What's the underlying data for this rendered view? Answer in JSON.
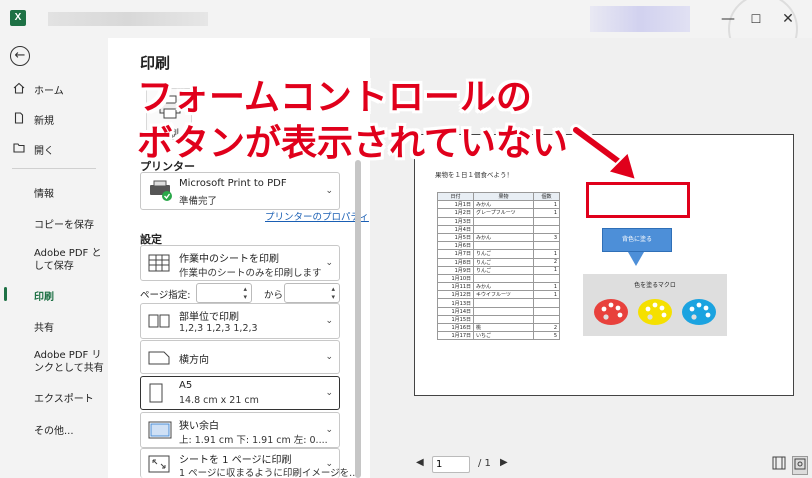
{
  "titlebar": {
    "app_icon": "excel-icon",
    "logo_letter": "X",
    "minimize_glyph": "—",
    "maximize_glyph": "☐",
    "close_glyph": "✕"
  },
  "nav": {
    "back_glyph": "←",
    "items": [
      {
        "label": "ホーム",
        "icon": "home-icon"
      },
      {
        "label": "新規",
        "icon": "new-file-icon"
      },
      {
        "label": "開く",
        "icon": "folder-open-icon"
      },
      {
        "label": "情報"
      },
      {
        "label": "コピーを保存"
      },
      {
        "label": "Adobe PDF と",
        "label2": "して保存"
      },
      {
        "label": "印刷",
        "active": true
      },
      {
        "label": "共有"
      },
      {
        "label": "Adobe PDF リ",
        "label2": "ンクとして共有"
      },
      {
        "label": "エクスポート"
      },
      {
        "label": "その他..."
      }
    ]
  },
  "print_pane": {
    "title": "印刷",
    "print_button_label": "印刷",
    "printer_section": "プリンター",
    "printer_name": "Microsoft Print to PDF",
    "printer_status": "準備完了",
    "printer_properties": "プリンターのプロパティ",
    "settings_section": "設定",
    "scope": {
      "l1": "作業中のシートを印刷",
      "l2": "作業中のシートのみを印刷します"
    },
    "page_spec_label": "ページ指定:",
    "page_to_label": "から",
    "collate": {
      "l1": "部単位で印刷",
      "l2": "1,2,3    1,2,3    1,2,3"
    },
    "orientation": {
      "l1": "横方向"
    },
    "paper": {
      "l1": "A5",
      "l2": "14.8 cm x 21 cm"
    },
    "margins": {
      "l1": "狭い余白",
      "l2": "上: 1.91 cm 下: 1.91 cm 左: 0...."
    },
    "scaling": {
      "l1": "シートを 1 ページに印刷",
      "l2": "1 ページに収まるように印刷イメージを..."
    }
  },
  "preview": {
    "sheet_title": "果物を１日１個食べよう！",
    "table_headers": [
      "日付",
      "果物",
      "個数"
    ],
    "rows": [
      [
        "1月1日",
        "みかん",
        "1"
      ],
      [
        "1月2日",
        "グレープフルーツ",
        "1"
      ],
      [
        "1月3日",
        "",
        ""
      ],
      [
        "1月4日",
        "",
        ""
      ],
      [
        "1月5日",
        "みかん",
        "3"
      ],
      [
        "1月6日",
        "",
        ""
      ],
      [
        "1月7日",
        "りんご",
        "1"
      ],
      [
        "1月8日",
        "りんご",
        "2"
      ],
      [
        "1月9日",
        "りんご",
        "1"
      ],
      [
        "1月10日",
        "",
        ""
      ],
      [
        "1月11日",
        "みかん",
        "1"
      ],
      [
        "1月12日",
        "キウイフルーツ",
        "1"
      ],
      [
        "1月13日",
        "",
        ""
      ],
      [
        "1月14日",
        "",
        ""
      ],
      [
        "1月15日",
        "",
        ""
      ],
      [
        "1月16日",
        "桃",
        "2"
      ],
      [
        "1月17日",
        "いちご",
        "5"
      ]
    ],
    "macro_button": "背色に塗る",
    "macro_box_label": "色を塗るマクロ",
    "palette_colors": [
      "#e8413c",
      "#f5e000",
      "#1ba3e0"
    ]
  },
  "pager": {
    "current_page": "1",
    "total": "/ 1"
  },
  "annotation": {
    "line1": "フォームコントロールの",
    "line2": "ボタンが表示されていない",
    "color": "#e0001b"
  }
}
